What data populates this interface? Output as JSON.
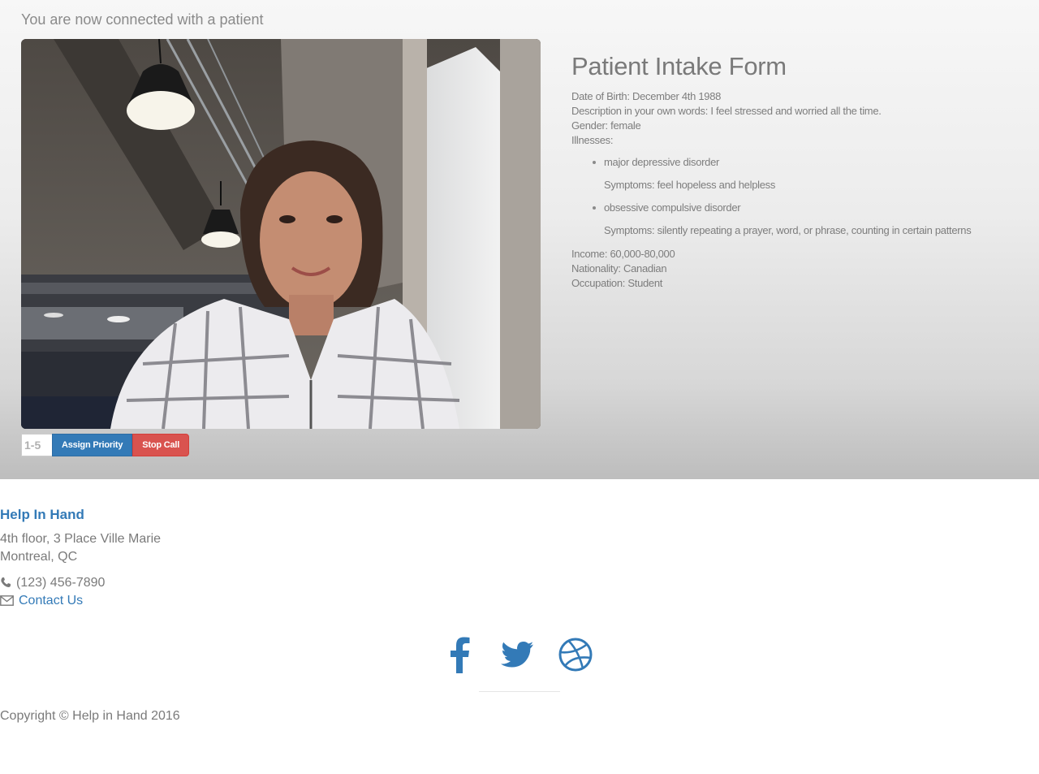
{
  "status": {
    "connected_message": "You are now connected with a patient"
  },
  "video": {
    "feed": "patient-webcam-video"
  },
  "controls": {
    "priority_placeholder": "1-5",
    "assign_label": "Assign Priority",
    "stop_label": "Stop Call",
    "colors": {
      "primary": "#337ab7",
      "danger": "#d9534f"
    }
  },
  "intake": {
    "title": "Patient Intake Form",
    "dob": "Date of Birth: December 4th 1988",
    "description": "Description in your own words: I feel stressed and worried all the time.",
    "gender": "Gender: female",
    "illnesses_label": "Illnesses:",
    "illnesses": [
      {
        "name": "major depressive disorder",
        "symptoms": "Symptoms: feel hopeless and helpless"
      },
      {
        "name": "obsessive compulsive disorder",
        "symptoms": "Symptoms: silently repeating a prayer, word, or phrase, counting in certain patterns"
      }
    ],
    "income": "Income: 60,000-80,000",
    "nationality": "Nationality: Canadian",
    "occupation": "Occupation: Student"
  },
  "footer": {
    "brand": "Help In Hand",
    "address_line1": "4th floor, 3 Place Ville Marie",
    "address_line2": "Montreal, QC",
    "phone": "(123) 456-7890",
    "contact_label": "Contact Us",
    "social_icons": [
      "facebook-icon",
      "twitter-icon",
      "dribbble-icon"
    ],
    "copyright": "Copyright © Help in Hand 2016",
    "link_color": "#337ab7"
  }
}
